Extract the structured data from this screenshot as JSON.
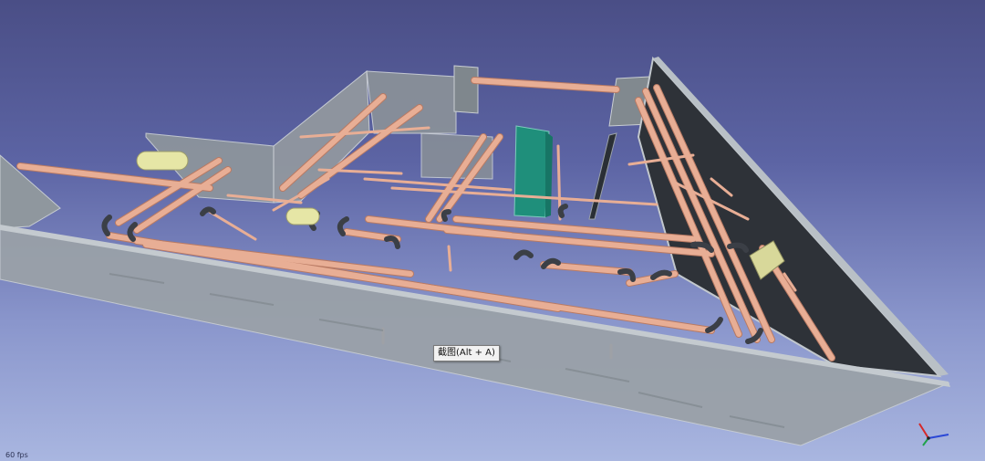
{
  "viewer": {
    "tooltip_text": "截图(Alt + A)",
    "fps_text": "60 fps"
  },
  "colors": {
    "background_top": "#4a4e86",
    "background_bottom": "#a9b6e0",
    "pipe": "#e3a58c",
    "pipe_edge": "#b97a63",
    "elbow": "#3b3f46",
    "wall_gray": "#9fa6ac",
    "wall_dark": "#2b2f35",
    "duct_green": "#1f8f7b",
    "cylinder_yellow": "#e6e6a6",
    "axis_x": "#d62828",
    "axis_y": "#1fa24a",
    "axis_z": "#2b48d6"
  },
  "icons": {
    "axis_indicator": "xyz-axis-icon"
  }
}
